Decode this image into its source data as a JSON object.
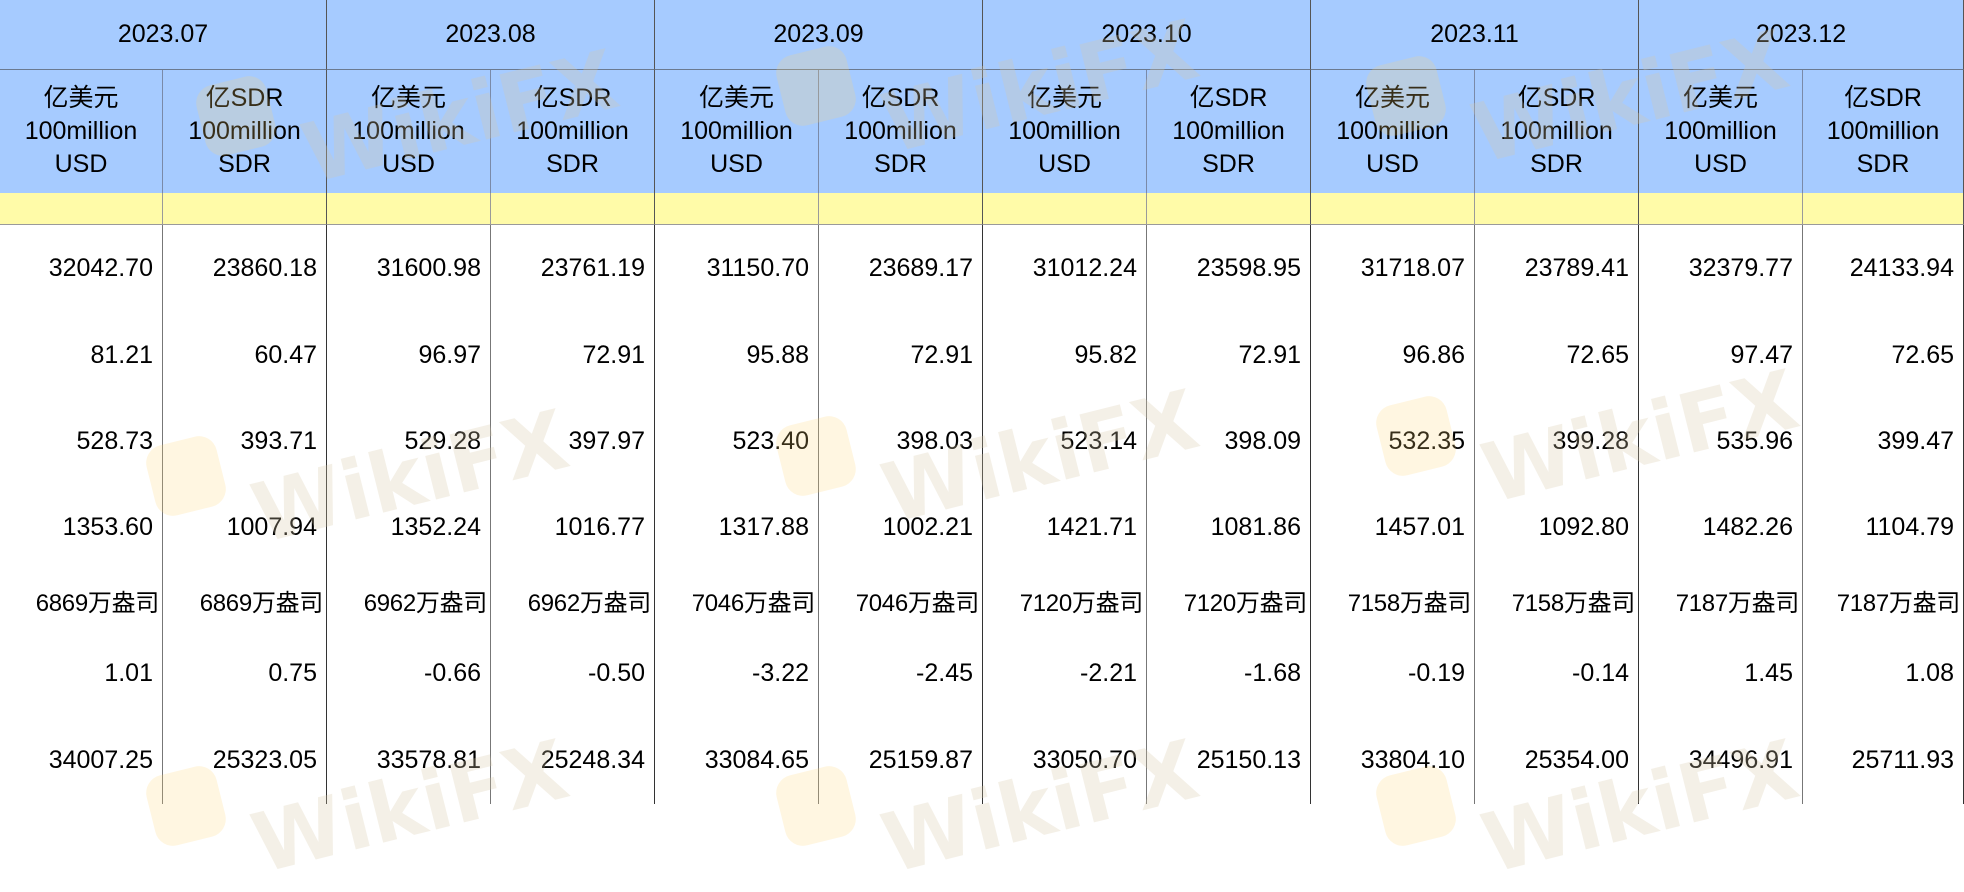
{
  "months": [
    "2023.07",
    "2023.08",
    "2023.09",
    "2023.10",
    "2023.11",
    "2023.12"
  ],
  "unit_headers": {
    "usd": "亿美元\n100million\nUSD",
    "sdr": "亿SDR\n100million\nSDR"
  },
  "rows": [
    [
      "32042.70",
      "23860.18",
      "31600.98",
      "23761.19",
      "31150.70",
      "23689.17",
      "31012.24",
      "23598.95",
      "31718.07",
      "23789.41",
      "32379.77",
      "24133.94"
    ],
    [
      "81.21",
      "60.47",
      "96.97",
      "72.91",
      "95.88",
      "72.91",
      "95.82",
      "72.91",
      "96.86",
      "72.65",
      "97.47",
      "72.65"
    ],
    [
      "528.73",
      "393.71",
      "529.28",
      "397.97",
      "523.40",
      "398.03",
      "523.14",
      "398.09",
      "532.35",
      "399.28",
      "535.96",
      "399.47"
    ],
    [
      "1353.60",
      "1007.94",
      "1352.24",
      "1016.77",
      "1317.88",
      "1002.21",
      "1421.71",
      "1081.86",
      "1457.01",
      "1092.80",
      "1482.26",
      "1104.79"
    ],
    [
      "6869万盎司",
      "6869万盎司",
      "6962万盎司",
      "6962万盎司",
      "7046万盎司",
      "7046万盎司",
      "7120万盎司",
      "7120万盎司",
      "7158万盎司",
      "7158万盎司",
      "7187万盎司",
      "7187万盎司"
    ],
    [
      "1.01",
      "0.75",
      "-0.66",
      "-0.50",
      "-3.22",
      "-2.45",
      "-2.21",
      "-1.68",
      "-0.19",
      "-0.14",
      "1.45",
      "1.08"
    ],
    [
      "34007.25",
      "25323.05",
      "33578.81",
      "25248.34",
      "33084.65",
      "25159.87",
      "33050.70",
      "25150.13",
      "33804.10",
      "25354.00",
      "34496.91",
      "25711.93"
    ]
  ],
  "watermark": "WikiFX"
}
